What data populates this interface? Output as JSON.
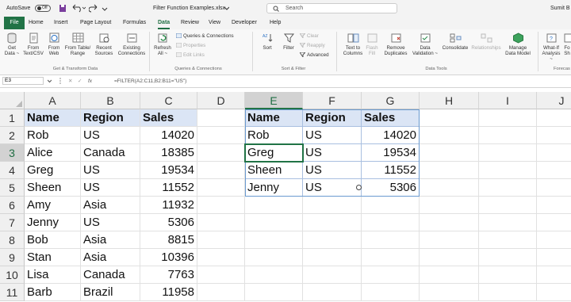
{
  "title_bar": {
    "autosave_label": "AutoSave",
    "autosave_state": "Off",
    "file_name": "Filter Function Examples.xlsx",
    "search_placeholder": "Search",
    "user_name": "Sumit B"
  },
  "menu_tabs": [
    "File",
    "Home",
    "Insert",
    "Page Layout",
    "Formulas",
    "Data",
    "Review",
    "View",
    "Developer",
    "Help"
  ],
  "active_tab": "Data",
  "ribbon": {
    "get_data": "Get Data ~",
    "from_text_csv": "From Text/CSV",
    "from_web": "From Web",
    "from_table_range": "From Table/ Range",
    "recent_sources": "Recent Sources",
    "existing_connections": "Existing Connections",
    "group_get_transform": "Get & Transform Data",
    "refresh_all": "Refresh All ~",
    "queries_connections": "Queries & Connections",
    "properties": "Properties",
    "edit_links": "Edit Links",
    "group_queries": "Queries & Connections",
    "sort": "Sort",
    "filter": "Filter",
    "clear": "Clear",
    "reapply": "Reapply",
    "advanced": "Advanced",
    "group_sort_filter": "Sort & Filter",
    "text_to_columns": "Text to Columns",
    "flash_fill": "Flash Fill",
    "remove_duplicates": "Remove Duplicates",
    "data_validation": "Data Validation ~",
    "consolidate": "Consolidate",
    "relationships": "Relationships",
    "manage_data_model": "Manage Data Model",
    "group_data_tools": "Data Tools",
    "what_if_analysis": "What-If Analysis ~",
    "forecast_sheet": "Fo Sh",
    "group_forecast": "Forecas"
  },
  "formula_bar": {
    "name_box": "E3",
    "formula": "=FILTER(A2:C11,B2:B11=\"US\")"
  },
  "columns": [
    "A",
    "B",
    "C",
    "D",
    "E",
    "F",
    "G",
    "H",
    "I",
    "J"
  ],
  "rows": [
    "1",
    "2",
    "3",
    "4",
    "5",
    "6",
    "7",
    "8",
    "9",
    "10",
    "11"
  ],
  "source_table": {
    "headers": [
      "Name",
      "Region",
      "Sales"
    ],
    "rows": [
      [
        "Rob",
        "US",
        "14020"
      ],
      [
        "Alice",
        "Canada",
        "18385"
      ],
      [
        "Greg",
        "US",
        "19534"
      ],
      [
        "Sheen",
        "US",
        "11552"
      ],
      [
        "Amy",
        "Asia",
        "11932"
      ],
      [
        "Jenny",
        "US",
        "5306"
      ],
      [
        "Bob",
        "Asia",
        "8815"
      ],
      [
        "Stan",
        "Asia",
        "10396"
      ],
      [
        "Lisa",
        "Canada",
        "7763"
      ],
      [
        "Barb",
        "Brazil",
        "11958"
      ]
    ]
  },
  "filtered_table": {
    "headers": [
      "Name",
      "Region",
      "Sales"
    ],
    "rows": [
      [
        "Rob",
        "US",
        "14020"
      ],
      [
        "Greg",
        "US",
        "19534"
      ],
      [
        "Sheen",
        "US",
        "11552"
      ],
      [
        "Jenny",
        "US",
        "5306"
      ]
    ]
  }
}
